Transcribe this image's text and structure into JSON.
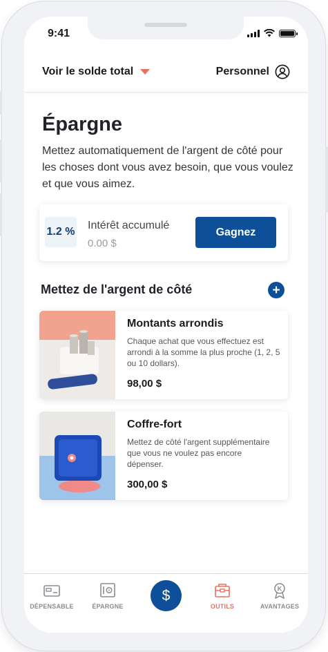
{
  "status_bar": {
    "time": "9:41"
  },
  "header": {
    "balance_toggle": "Voir le solde total",
    "profile_label": "Personnel"
  },
  "page": {
    "title": "Épargne",
    "intro": "Mettez automatiquement de l'argent de côté pour les choses dont vous avez besoin, que vous voulez et que vous aimez."
  },
  "interest": {
    "rate": "1.2 %",
    "label": "Intérêt accumulé",
    "amount": "0.00 $",
    "earn_button": "Gagnez"
  },
  "savings_section": {
    "title": "Mettez de l'argent de côté",
    "add_symbol": "+",
    "cards": [
      {
        "title": "Montants arrondis",
        "description": "Chaque achat que vous effectuez est arrondi à la somme la plus proche (1, 2, 5 ou 10 dollars).",
        "amount": "98,00 $"
      },
      {
        "title": "Coffre-fort",
        "description": "Mettez de côté l'argent supplémentaire que vous ne voulez pas encore dépenser.",
        "amount": "300,00 $"
      }
    ]
  },
  "bottom_nav": {
    "items": [
      {
        "label": "DÉPENSABLE",
        "icon": "wallet-card-icon"
      },
      {
        "label": "ÉPARGNE",
        "icon": "safe-icon"
      },
      {
        "label": "$",
        "icon": "dollar-icon"
      },
      {
        "label": "OUTILS",
        "icon": "toolbox-icon",
        "active": true
      },
      {
        "label": "AVANTAGES",
        "icon": "badge-ribbon-icon"
      }
    ]
  },
  "colors": {
    "primary_blue": "#0d4f98",
    "accent_coral": "#e8705d",
    "text_dark": "#1b1b1f",
    "muted_gray": "#9a9ba1"
  }
}
